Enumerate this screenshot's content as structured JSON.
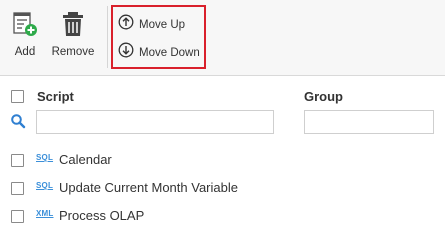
{
  "toolbar": {
    "add_label": "Add",
    "remove_label": "Remove",
    "move_up_label": "Move Up",
    "move_down_label": "Move Down"
  },
  "grid": {
    "columns": {
      "script": "Script",
      "group": "Group"
    },
    "filters": {
      "script": "",
      "group": ""
    },
    "rows": [
      {
        "type": "SQL",
        "name": "Calendar"
      },
      {
        "type": "SQL",
        "name": "Update Current Month Variable"
      },
      {
        "type": "XML",
        "name": "Process OLAP"
      }
    ]
  },
  "colors": {
    "highlight": "#d9202b",
    "accent_green": "#2eaa4a",
    "file_type": "#3b8fd9",
    "search_icon": "#2f7fd1"
  }
}
